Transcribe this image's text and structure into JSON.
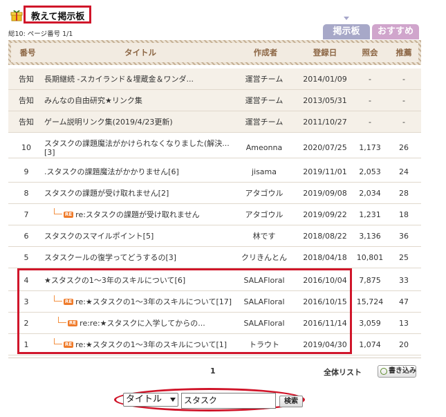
{
  "board": {
    "title": "教えて掲示板",
    "summary": "総10: ページ番号 1/1"
  },
  "tabs": [
    {
      "label": "掲示板"
    },
    {
      "label": "おすすめ"
    }
  ],
  "columns": {
    "num": "番号",
    "title": "タイトル",
    "author": "作成者",
    "date": "登録日",
    "views": "照会",
    "recommend": "推薦"
  },
  "notices": [
    {
      "num": "告知",
      "title": "長期継続 -スカイランド＆埋蔵金＆ワンダ...",
      "author": "運営チーム",
      "date": "2014/01/09",
      "views": "-",
      "recommend": "-"
    },
    {
      "num": "告知",
      "title": "みんなの自由研究★リンク集",
      "author": "運営チーム",
      "date": "2013/05/31",
      "views": "-",
      "recommend": "-"
    },
    {
      "num": "告知",
      "title": "ゲーム説明リンク集(2019/4/23更新)",
      "author": "運営チーム",
      "date": "2011/10/27",
      "views": "-",
      "recommend": "-"
    }
  ],
  "posts": [
    {
      "num": "10",
      "title": "スタスクの課題魔法がかけられなくなりました(解決...",
      "title_line2": "[3]",
      "author": "Ameonna",
      "date": "2020/07/25",
      "views": "1,173",
      "recommend": "26"
    },
    {
      "num": "9",
      "title": ".スタスクの課題魔法がかかりません[6]",
      "author": "jisama",
      "date": "2019/11/01",
      "views": "2,053",
      "recommend": "24"
    },
    {
      "num": "8",
      "title": "スタスクの課題が受け取れません[2]",
      "author": "アタゴウル",
      "date": "2019/09/08",
      "views": "2,034",
      "recommend": "28"
    },
    {
      "num": "7",
      "reply_tag": "RE",
      "title": "re:スタスクの課題が受け取れません",
      "author": "アタゴウル",
      "date": "2019/09/22",
      "views": "1,231",
      "recommend": "18"
    },
    {
      "num": "6",
      "title": "スタスクのスマイルポイント[5]",
      "author": "林です",
      "date": "2018/08/22",
      "views": "3,136",
      "recommend": "36"
    },
    {
      "num": "5",
      "title": "スタスクールの復学ってどうするの[3]",
      "author": "クリきんとん",
      "date": "2018/04/18",
      "views": "10,801",
      "recommend": "25"
    },
    {
      "num": "4",
      "title": "★スタスクの1～3年のスキルについて[6]",
      "author": "SALAFloral",
      "date": "2016/10/04",
      "views": "7,875",
      "recommend": "33"
    },
    {
      "num": "3",
      "reply_tag": "RE",
      "title": "re:★スタスクの1～3年のスキルについて[17]",
      "author": "SALAFloral",
      "date": "2016/10/15",
      "views": "15,724",
      "recommend": "47"
    },
    {
      "num": "2",
      "reply_tag": "RE",
      "title": "re:re:★スタスクに入学してからの...",
      "author": "SALAFloral",
      "date": "2016/11/14",
      "views": "3,059",
      "recommend": "13"
    },
    {
      "num": "1",
      "reply_tag": "RE",
      "title": "re:★スタスクの1～3年のスキルについて[1]",
      "author": "トラウト",
      "date": "2019/04/30",
      "views": "1,074",
      "recommend": "20"
    }
  ],
  "pager": {
    "current": "1"
  },
  "footer": {
    "all_list": "全体リスト",
    "write": "書き込み"
  },
  "search": {
    "field": "タイトル",
    "query": "スタスク",
    "button": "検索"
  },
  "colors": {
    "highlight": "#d0152a",
    "tab_board": "#a7a8c8",
    "tab_recommend": "#d0a5cc",
    "header_text": "#8c6644",
    "reply": "#ef7b2b"
  },
  "icons": {
    "board_icon": "gift-icon",
    "reply_icon": "reply-arrow-icon",
    "write_icon": "pen-icon",
    "select_icon": "chevron-down-icon"
  }
}
